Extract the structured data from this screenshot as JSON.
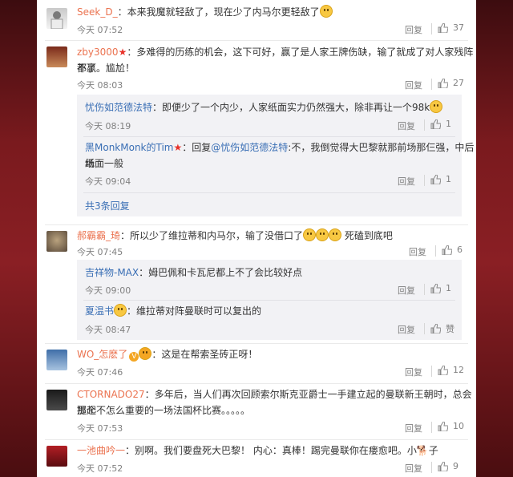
{
  "colors": {
    "accent": "#eb7350",
    "link_blue": "#3a6fb5",
    "sub_bg": "#f2f2f5"
  },
  "comments": [
    {
      "user": "Seek_D_",
      "text": "：本来我魔就轻敌了，现在少了内马尔更轻敌了",
      "time": "今天 07:52",
      "reply": "回复",
      "likes": "37"
    },
    {
      "user": "zby3000",
      "text1": "：多难得的历练的机会，这下可好，赢了是人家王牌伤缺，输了就成了对人家残阵都赢",
      "text2": "不了。尴尬！",
      "time": "今天 08:03",
      "reply": "回复",
      "likes": "27",
      "subs": [
        {
          "user": "忧伤如范德法特",
          "text": "：即便少了一个内少，人家纸面实力仍然强大，除非再让一个98k",
          "time": "今天 08:19",
          "reply": "回复",
          "likes": "1"
        },
        {
          "user": "黑MonkMonk的Tim",
          "mid": "：回复",
          "mention": "@忧伤如范德法特",
          "text1": ":不，我倒觉得大巴黎就那前场那仨强，中后场",
          "text2": "纸面一般",
          "time": "今天 09:04",
          "reply": "回复",
          "likes": "1"
        }
      ],
      "more": "共3条回复"
    },
    {
      "user": "郝霸霸_琦",
      "text": "：所以少了维拉蒂和内马尔，输了没借口了",
      "text_tail": "死磕到底吧",
      "time": "今天 07:45",
      "reply": "回复",
      "likes": "6",
      "subs": [
        {
          "user": "吉祥物-MAX",
          "text": "：姆巴佩和卡瓦尼都上不了会比较好点",
          "time": "今天 09:00",
          "reply": "回复",
          "likes": "1"
        },
        {
          "user": "夏温书",
          "text": "：维拉蒂对阵曼联时可以复出的",
          "time": "今天 08:47",
          "reply": "回复",
          "likes": "赞"
        }
      ]
    },
    {
      "user": "WO_怎麽了",
      "text": "：这是在帮索圣砖正呀！",
      "time": "今天 07:46",
      "reply": "回复",
      "likes": "12"
    },
    {
      "user": "CTORNADO27",
      "text1": "：多年后，当人们再次回顾索尔斯克亚爵士一手建立起的曼联新王朝时，总会提起",
      "text2": "那个不怎么重要的一场法国杯比赛。。。。。",
      "time": "今天 07:53",
      "reply": "回复",
      "likes": "10"
    },
    {
      "user": "一池曲吟一",
      "text": "：别啊。我们要盘死大巴黎！  内心：真棒！踢完曼联你在瘘愈吧。小",
      "text_tail": "子",
      "time": "今天 07:52",
      "reply": "回复",
      "likes": "9"
    }
  ]
}
